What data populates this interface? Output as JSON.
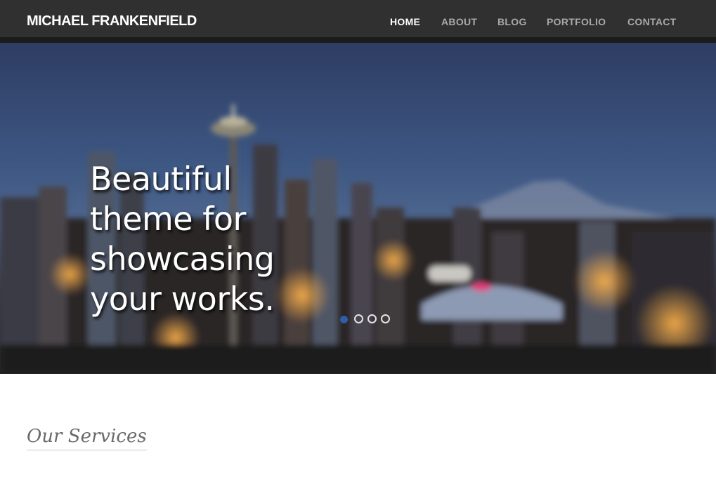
{
  "header": {
    "brand": "MICHAEL FRANKENFIELD",
    "nav": [
      {
        "label": "HOME",
        "active": true
      },
      {
        "label": "ABOUT",
        "active": false
      },
      {
        "label": "BLOG",
        "active": false
      },
      {
        "label": "PORTFOLIO",
        "active": false
      },
      {
        "label": "CONTACT",
        "active": false
      }
    ]
  },
  "hero": {
    "headline_lines": [
      "Beautiful",
      "theme for",
      "showcasing",
      "your works."
    ],
    "slides_total": 4,
    "active_slide": 1
  },
  "services": {
    "title": "Our Services"
  },
  "colors": {
    "navbar_bg": "#303030",
    "nav_active": "#ffffff",
    "nav_inactive": "#a9a9a9",
    "slider_dot_active": "#2f5da8"
  }
}
